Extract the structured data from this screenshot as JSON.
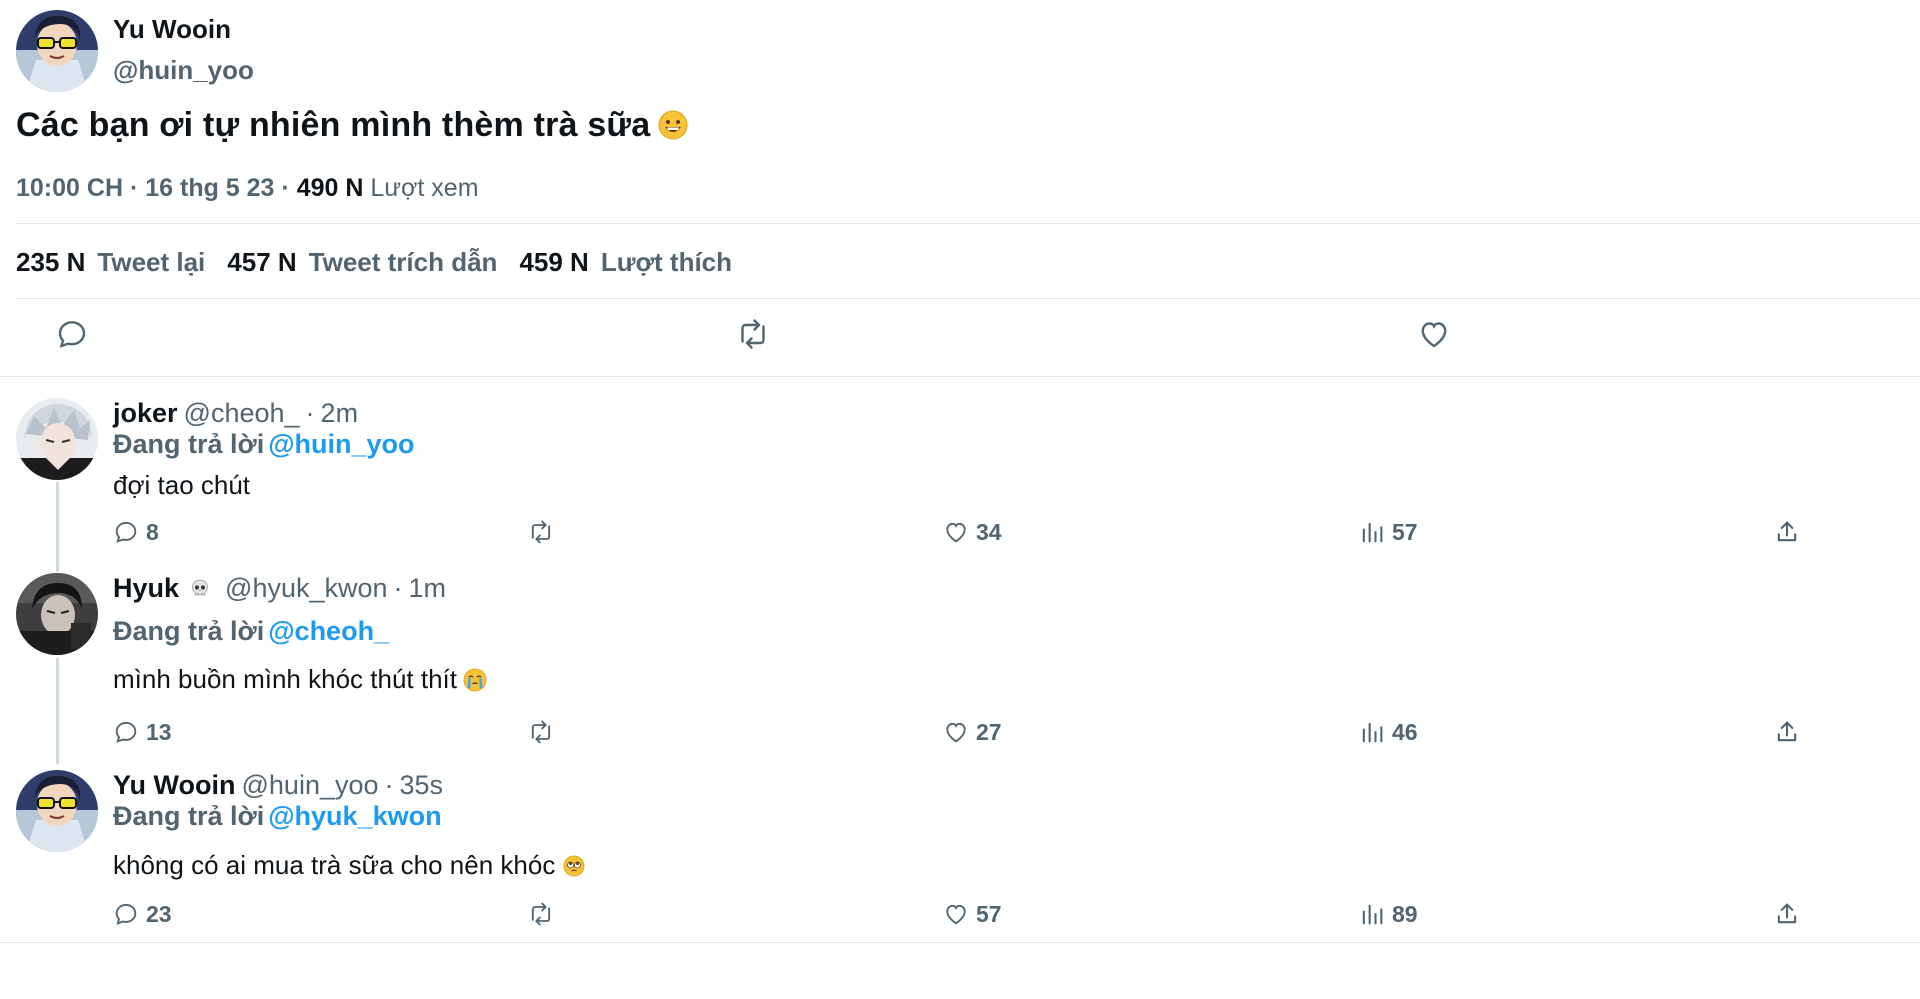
{
  "main_tweet": {
    "author_name": "Yu Wooin",
    "author_handle": "@huin_yoo",
    "text": "Các bạn ơi tự nhiên mình thèm trà sữa",
    "emoji_icon": "grinning-face-emoji",
    "time": "10:00 CH",
    "date": "16 thg 5 23",
    "separator": "·",
    "views_count": "490 N",
    "views_label": "Lượt xem",
    "retweets_count": "235 N",
    "retweets_label": "Tweet lại",
    "quotes_count": "457 N",
    "quotes_label": "Tweet trích dẫn",
    "likes_count": "459 N",
    "likes_label": "Lượt thích",
    "actions": [
      "reply-icon",
      "retweet-icon",
      "like-icon"
    ]
  },
  "replies": [
    {
      "name": "joker",
      "handle": "@cheoh_",
      "time": "2m",
      "replying_label": "Đang trả lời",
      "replying_to": "@huin_yoo",
      "text": "đợi tao chút",
      "reply_count": "8",
      "like_count": "34",
      "view_count": "57"
    },
    {
      "name": "Hyuk",
      "handle": "@hyuk_kwon",
      "time": "1m",
      "name_emoji": "skull-emoji",
      "replying_label": "Đang trả lời",
      "replying_to": "@cheoh_",
      "text": "mình buồn mình khóc thút thít",
      "text_emoji": "crying-face-emoji",
      "reply_count": "13",
      "like_count": "27",
      "view_count": "46"
    },
    {
      "name": "Yu Wooin",
      "handle": "@huin_yoo",
      "time": "35s",
      "replying_label": "Đang trả lời",
      "replying_to": "@hyuk_kwon",
      "text": "không có ai mua trà sữa cho nên khóc",
      "text_emoji": "pleading-face-emoji",
      "reply_count": "23",
      "like_count": "57",
      "view_count": "89"
    }
  ],
  "colors": {
    "text": "#0f1419",
    "secondary": "#536471",
    "mention": "#1d9bf0",
    "divider": "#e6e9ea"
  }
}
